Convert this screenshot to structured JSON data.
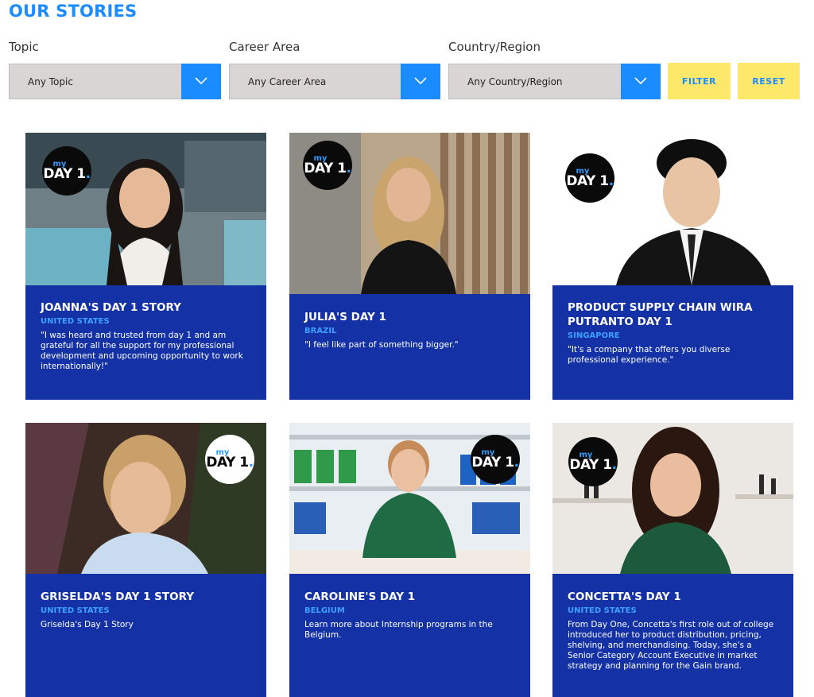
{
  "header": {
    "title": "OUR STORIES"
  },
  "filters": {
    "topic": {
      "label": "Topic",
      "value": "Any Topic"
    },
    "career": {
      "label": "Career Area",
      "value": "Any Career Area"
    },
    "country": {
      "label": "Country/Region",
      "value": "Any Country/Region"
    },
    "filter_button": "FILTER",
    "reset_button": "RESET"
  },
  "badge": {
    "my": "my",
    "day": "DAY 1",
    "dot": "."
  },
  "stories": [
    {
      "name": "JOANNA'S DAY 1 STORY",
      "country": "UNITED STATES",
      "blurb": "\"I was heard and trusted from day 1 and am grateful for all the support for my professional development and upcoming opportunity to work internationally!\""
    },
    {
      "name": "JULIA'S DAY 1",
      "country": "BRAZIL",
      "blurb": "\"I feel like part of something bigger.\""
    },
    {
      "name": "PRODUCT SUPPLY CHAIN WIRA PUTRANTO DAY 1",
      "country": "SINGAPORE",
      "blurb": "\"It's a company that offers you diverse professional experience.\""
    },
    {
      "name": "GRISELDA'S DAY 1 STORY",
      "country": "UNITED STATES",
      "blurb": "Griselda's Day 1 Story"
    },
    {
      "name": "CAROLINE'S DAY 1",
      "country": "BELGIUM",
      "blurb": "Learn more about Internship programs in the Belgium."
    },
    {
      "name": "CONCETTA'S DAY 1",
      "country": "UNITED STATES",
      "blurb": "From Day One, Concetta's first role out of college introduced her to product distribution, pricing, shelving, and merchandising. Today, she's a Senior Category Account Executive in market strategy and planning for the Gain brand."
    }
  ],
  "colors": {
    "accent": "#1a8cff",
    "card_bg": "#1432a6",
    "button_yellow": "#fde86a",
    "select_bg": "#d9d5d5"
  }
}
